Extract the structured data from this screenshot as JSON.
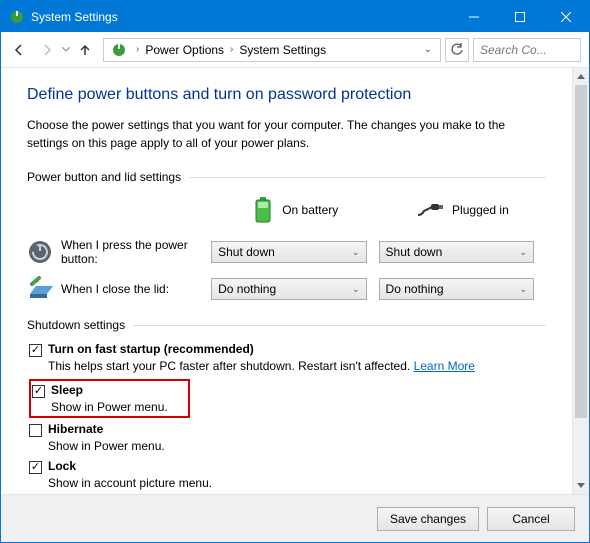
{
  "window": {
    "title": "System Settings"
  },
  "breadcrumb": {
    "item1": "Power Options",
    "item2": "System Settings"
  },
  "search": {
    "placeholder": "Search Co..."
  },
  "heading": "Define power buttons and turn on password protection",
  "desc": "Choose the power settings that you want for your computer. The changes you make to the settings on this page apply to all of your power plans.",
  "section1": {
    "label": "Power button and lid settings"
  },
  "cols": {
    "battery": "On battery",
    "plugged": "Plugged in"
  },
  "rows": {
    "power": {
      "label": "When I press the power button:",
      "battery": "Shut down",
      "plugged": "Shut down"
    },
    "lid": {
      "label": "When I close the lid:",
      "battery": "Do nothing",
      "plugged": "Do nothing"
    }
  },
  "section2": {
    "label": "Shutdown settings"
  },
  "shutdown": {
    "fast": {
      "label": "Turn on fast startup (recommended)",
      "sub": "This helps start your PC faster after shutdown. Restart isn't affected. ",
      "link": "Learn More"
    },
    "sleep": {
      "label": "Sleep",
      "sub": "Show in Power menu."
    },
    "hib": {
      "label": "Hibernate",
      "sub": "Show in Power menu."
    },
    "lock": {
      "label": "Lock",
      "sub": "Show in account picture menu."
    }
  },
  "footer": {
    "save": "Save changes",
    "cancel": "Cancel"
  }
}
